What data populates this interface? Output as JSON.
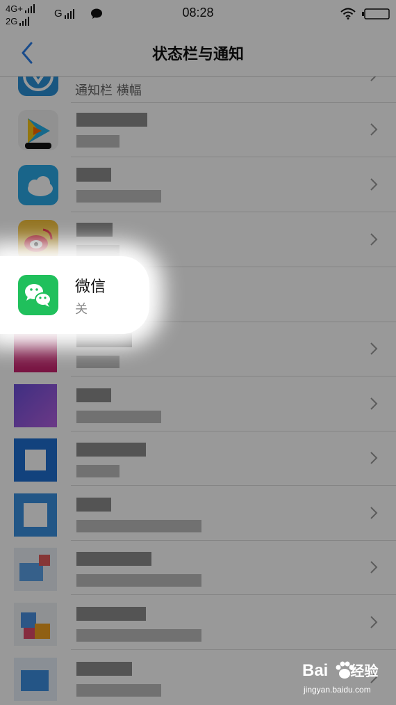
{
  "status_bar": {
    "network_primary": "4G+",
    "network_secondary": "2G",
    "network_tertiary": "G",
    "time": "08:28",
    "icons": [
      "signal-icon",
      "chat-bubble-icon",
      "wifi-icon",
      "battery-icon"
    ]
  },
  "header": {
    "title": "状态栏与通知",
    "back_icon": "chevron-left-icon",
    "accent_color": "#2a7ee8"
  },
  "list": {
    "partial_top_label": "通知栏 横幅",
    "items": [
      {
        "name": "微信",
        "status": "关",
        "icon": "wechat-icon",
        "color": "#20c05c"
      }
    ],
    "chevron_icon": "chevron-right-icon"
  },
  "watermark": {
    "brand": "Bai",
    "brand_suffix": "经验",
    "url": "jingyan.baidu.com"
  }
}
